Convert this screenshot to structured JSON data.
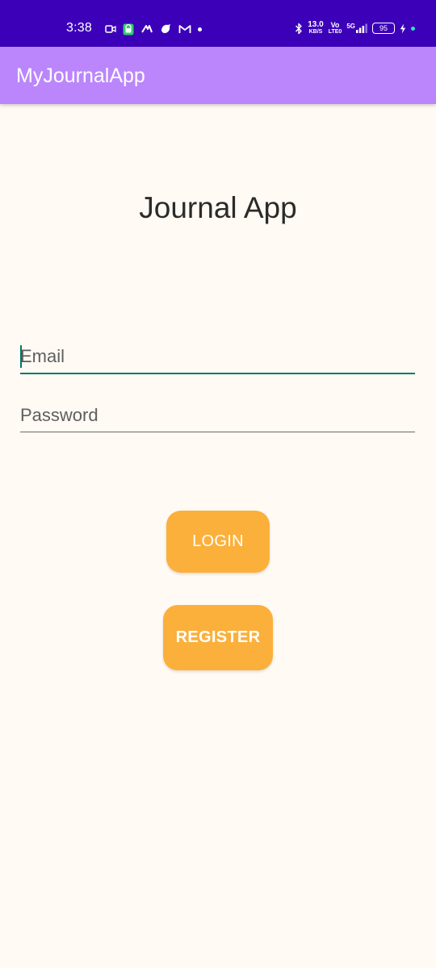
{
  "status_bar": {
    "time": "3:38",
    "speed_value": "13.0",
    "speed_unit": "KB/S",
    "volte_top": "Vo",
    "volte_bottom": "LTE0",
    "network": "5G",
    "battery": "95"
  },
  "app_bar": {
    "title": "MyJournalApp"
  },
  "main": {
    "headline": "Journal App",
    "email_placeholder": "Email",
    "password_placeholder": "Password",
    "login_label": "LOGIN",
    "register_label": "REGISTER"
  },
  "colors": {
    "status_bar": "#3c00b8",
    "app_bar": "#bb86fc",
    "background": "#fffaf3",
    "button": "#fbb03b",
    "focus_underline": "#00796b"
  }
}
